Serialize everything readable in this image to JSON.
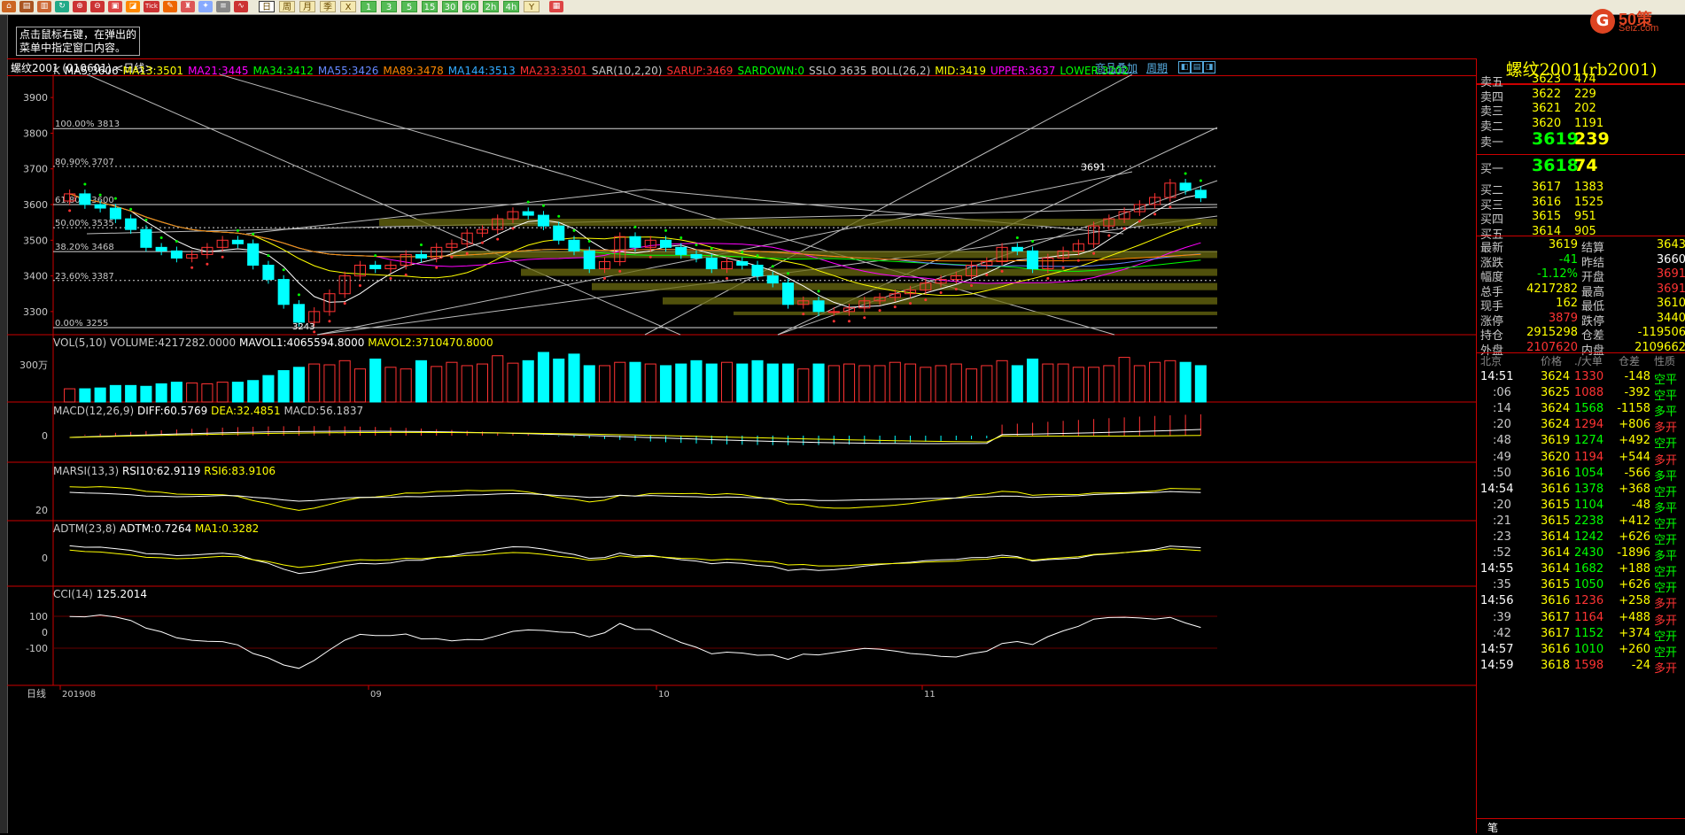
{
  "toolbar": {
    "icons": [
      "home-icon",
      "folder-icon",
      "book-icon",
      "refresh-icon",
      "zoom-in-icon",
      "zoom-out-icon",
      "layers-icon",
      "chart-icon",
      "ink-icon",
      "cup-icon",
      "new-icon",
      "list-icon",
      "line-chart-icon"
    ],
    "tick_label": "Tick",
    "periods": [
      "日",
      "周",
      "月",
      "季",
      "X",
      "1",
      "3",
      "5",
      "15",
      "30",
      "60",
      "2h",
      "4h",
      "Y"
    ],
    "active_period": "日"
  },
  "tooltip": {
    "line1": "点击鼠标右键，在弹出的",
    "line2": "菜单中指定窗口内容。"
  },
  "logo": {
    "mark": "G",
    "text": "50策",
    "sub": "Seiz.com"
  },
  "header": {
    "name": "螺纹2001 (010601) <日线>",
    "link1": "商品叠加",
    "link2": "周期"
  },
  "main": {
    "indicator_items": [
      {
        "text": "K",
        "color": "#c8c8c8"
      },
      {
        "text": "MA5:3606",
        "color": "#ffffff"
      },
      {
        "text": "MA13:3501",
        "color": "#ffff00"
      },
      {
        "text": "MA21:3445",
        "color": "#ff00ff"
      },
      {
        "text": "MA34:3412",
        "color": "#00ff00"
      },
      {
        "text": "MA55:3426",
        "color": "#6688ff"
      },
      {
        "text": "MA89:3478",
        "color": "#ff8800"
      },
      {
        "text": "MA144:3513",
        "color": "#33aaff"
      },
      {
        "text": "MA233:3501",
        "color": "#ff3333"
      },
      {
        "text": "SAR(10,2,20)",
        "color": "#c8c8c8"
      },
      {
        "text": "SARUP:3469",
        "color": "#ff3333"
      },
      {
        "text": "SARDOWN:0",
        "color": "#00ff00"
      },
      {
        "text": "SSLO 3635",
        "color": "#c8c8c8"
      },
      {
        "text": "BOLL(26,2)",
        "color": "#c8c8c8"
      },
      {
        "text": "MID:3419",
        "color": "#ffff00"
      },
      {
        "text": "UPPER:3637",
        "color": "#ff00ff"
      },
      {
        "text": "LOWER:3202",
        "color": "#00ff00"
      }
    ],
    "y_ticks": [
      "3900",
      "3800",
      "3700",
      "3600",
      "3500",
      "3400",
      "3300"
    ],
    "fib_labels": [
      "100.00% 3813",
      "80.90% 3707",
      "61.80% 3600",
      "50.00% 3535",
      "38.20% 3468",
      "23.60% 3387",
      "0.00% 3255"
    ],
    "high_label": "3691",
    "low_label": "3243"
  },
  "vol": {
    "label": "VOL(5,10)",
    "volume": "VOLUME:4217282.0000",
    "mavol1": "MAVOL1:4065594.8000",
    "mavol2": "MAVOL2:3710470.8000",
    "tick": "300万"
  },
  "macd": {
    "label": "MACD(12,26,9)",
    "diff": "DIFF:60.5769",
    "dea": "DEA:32.4851",
    "macd": "MACD:56.1837",
    "tick": "0"
  },
  "marsi": {
    "label": "MARSI(13,3)",
    "rsi10": "RSI10:62.9119",
    "rsi6": "RSI6:83.9106",
    "tick": "20"
  },
  "adtm": {
    "label": "ADTM(23,8)",
    "adtm": "ADTM:0.7264",
    "ma1": "MA1:0.3282",
    "tick": "0"
  },
  "cci": {
    "label": "CCI(14)",
    "value": "125.2014",
    "ticks": [
      "100",
      "0",
      "-100"
    ]
  },
  "xaxis": {
    "period": "日线",
    "labels": [
      "201908",
      "09",
      "10",
      "11"
    ]
  },
  "quote": {
    "title": "螺纹2001(rb2001)",
    "asks": [
      {
        "label": "卖五",
        "price": "3623",
        "vol": "474"
      },
      {
        "label": "卖四",
        "price": "3622",
        "vol": "229"
      },
      {
        "label": "卖三",
        "price": "3621",
        "vol": "202"
      },
      {
        "label": "卖二",
        "price": "3620",
        "vol": "1191"
      },
      {
        "label": "卖一",
        "price": "3619",
        "vol": "239"
      }
    ],
    "bids": [
      {
        "label": "买一",
        "price": "3618",
        "vol": "74"
      },
      {
        "label": "买二",
        "price": "3617",
        "vol": "1383"
      },
      {
        "label": "买三",
        "price": "3616",
        "vol": "1525"
      },
      {
        "label": "买四",
        "price": "3615",
        "vol": "951"
      },
      {
        "label": "买五",
        "price": "3614",
        "vol": "905"
      }
    ],
    "stats": [
      {
        "l1": "最新",
        "v1": "3619",
        "c1": "#ffff00",
        "l2": "结算",
        "v2": "3643",
        "c2": "#ffff00"
      },
      {
        "l1": "涨跌",
        "v1": "-41",
        "c1": "#00ff00",
        "l2": "昨结",
        "v2": "3660",
        "c2": "#ffffff"
      },
      {
        "l1": "幅度",
        "v1": "-1.12%",
        "c1": "#00ff00",
        "l2": "开盘",
        "v2": "3691",
        "c2": "#ff3333"
      },
      {
        "l1": "总手",
        "v1": "4217282",
        "c1": "#ffff00",
        "l2": "最高",
        "v2": "3691",
        "c2": "#ff3333"
      },
      {
        "l1": "现手",
        "v1": "162",
        "c1": "#ffff00",
        "l2": "最低",
        "v2": "3610",
        "c2": "#ffff00"
      },
      {
        "l1": "涨停",
        "v1": "3879",
        "c1": "#ff3333",
        "l2": "跌停",
        "v2": "3440",
        "c2": "#ffff00"
      },
      {
        "l1": "持仓",
        "v1": "2915298",
        "c1": "#ffff00",
        "l2": "仓差",
        "v2": "-119506",
        "c2": "#ffff00"
      },
      {
        "l1": "外盘",
        "v1": "2107620",
        "c1": "#ff3333",
        "l2": "内盘",
        "v2": "2109662",
        "c2": "#ffff00"
      }
    ],
    "ticks_header": {
      "time": "北京",
      "price": "价格",
      "vol": "./大单",
      "diff": "仓差",
      "nature": "性质"
    },
    "ticks": [
      {
        "time": "14:51",
        "price": "3624",
        "vol": "1330",
        "diff": "-148",
        "nature": "空平",
        "tc": "#ffffff",
        "pc": "#ffff00",
        "vc": "#ff3333",
        "dc": "#ffff00",
        "nc": "#00ff00"
      },
      {
        "time": ":06",
        "price": "3625",
        "vol": "1088",
        "diff": "-392",
        "nature": "空平",
        "tc": "#c8c8c8",
        "pc": "#ffff00",
        "vc": "#ff3333",
        "dc": "#ffff00",
        "nc": "#00ff00"
      },
      {
        "time": ":14",
        "price": "3624",
        "vol": "1568",
        "diff": "-1158",
        "nature": "多平",
        "tc": "#c8c8c8",
        "pc": "#ffff00",
        "vc": "#00ff00",
        "dc": "#ffff00",
        "nc": "#00ff00"
      },
      {
        "time": ":20",
        "price": "3624",
        "vol": "1294",
        "diff": "+806",
        "nature": "多开",
        "tc": "#c8c8c8",
        "pc": "#ffff00",
        "vc": "#ff3333",
        "dc": "#ffff00",
        "nc": "#ff3333"
      },
      {
        "time": ":48",
        "price": "3619",
        "vol": "1274",
        "diff": "+492",
        "nature": "空开",
        "tc": "#c8c8c8",
        "pc": "#ffff00",
        "vc": "#00ff00",
        "dc": "#ffff00",
        "nc": "#00ff00"
      },
      {
        "time": ":49",
        "price": "3620",
        "vol": "1194",
        "diff": "+544",
        "nature": "多开",
        "tc": "#c8c8c8",
        "pc": "#ffff00",
        "vc": "#ff3333",
        "dc": "#ffff00",
        "nc": "#ff3333"
      },
      {
        "time": ":50",
        "price": "3616",
        "vol": "1054",
        "diff": "-566",
        "nature": "多平",
        "tc": "#c8c8c8",
        "pc": "#ffff00",
        "vc": "#00ff00",
        "dc": "#ffff00",
        "nc": "#00ff00"
      },
      {
        "time": "14:54",
        "price": "3616",
        "vol": "1378",
        "diff": "+368",
        "nature": "空开",
        "tc": "#ffffff",
        "pc": "#ffff00",
        "vc": "#00ff00",
        "dc": "#ffff00",
        "nc": "#00ff00"
      },
      {
        "time": ":20",
        "price": "3615",
        "vol": "1104",
        "diff": "-48",
        "nature": "多平",
        "tc": "#c8c8c8",
        "pc": "#ffff00",
        "vc": "#00ff00",
        "dc": "#ffff00",
        "nc": "#00ff00"
      },
      {
        "time": ":21",
        "price": "3615",
        "vol": "2238",
        "diff": "+412",
        "nature": "空开",
        "tc": "#c8c8c8",
        "pc": "#ffff00",
        "vc": "#00ff00",
        "dc": "#ffff00",
        "nc": "#00ff00"
      },
      {
        "time": ":23",
        "price": "3614",
        "vol": "1242",
        "diff": "+626",
        "nature": "空开",
        "tc": "#c8c8c8",
        "pc": "#ffff00",
        "vc": "#00ff00",
        "dc": "#ffff00",
        "nc": "#00ff00"
      },
      {
        "time": ":52",
        "price": "3614",
        "vol": "2430",
        "diff": "-1896",
        "nature": "多平",
        "tc": "#c8c8c8",
        "pc": "#ffff00",
        "vc": "#00ff00",
        "dc": "#ffff00",
        "nc": "#00ff00"
      },
      {
        "time": "14:55",
        "price": "3614",
        "vol": "1682",
        "diff": "+188",
        "nature": "空开",
        "tc": "#ffffff",
        "pc": "#ffff00",
        "vc": "#00ff00",
        "dc": "#ffff00",
        "nc": "#00ff00"
      },
      {
        "time": ":35",
        "price": "3615",
        "vol": "1050",
        "diff": "+626",
        "nature": "空开",
        "tc": "#c8c8c8",
        "pc": "#ffff00",
        "vc": "#00ff00",
        "dc": "#ffff00",
        "nc": "#00ff00"
      },
      {
        "time": "14:56",
        "price": "3616",
        "vol": "1236",
        "diff": "+258",
        "nature": "多开",
        "tc": "#ffffff",
        "pc": "#ffff00",
        "vc": "#ff3333",
        "dc": "#ffff00",
        "nc": "#ff3333"
      },
      {
        "time": ":39",
        "price": "3617",
        "vol": "1164",
        "diff": "+488",
        "nature": "多开",
        "tc": "#c8c8c8",
        "pc": "#ffff00",
        "vc": "#ff3333",
        "dc": "#ffff00",
        "nc": "#ff3333"
      },
      {
        "time": ":42",
        "price": "3617",
        "vol": "1152",
        "diff": "+374",
        "nature": "空开",
        "tc": "#c8c8c8",
        "pc": "#ffff00",
        "vc": "#00ff00",
        "dc": "#ffff00",
        "nc": "#00ff00"
      },
      {
        "time": "14:57",
        "price": "3616",
        "vol": "1010",
        "diff": "+260",
        "nature": "空开",
        "tc": "#ffffff",
        "pc": "#ffff00",
        "vc": "#00ff00",
        "dc": "#ffff00",
        "nc": "#00ff00"
      },
      {
        "time": "14:59",
        "price": "3618",
        "vol": "1598",
        "diff": "-24",
        "nature": "多开",
        "tc": "#ffffff",
        "pc": "#ffff00",
        "vc": "#ff3333",
        "dc": "#ffff00",
        "nc": "#ff3333"
      }
    ],
    "bottom_tab": "笔"
  },
  "chart_data": {
    "type": "candlestick",
    "closes": [
      3630,
      3600,
      3590,
      3560,
      3530,
      3480,
      3470,
      3450,
      3460,
      3480,
      3500,
      3490,
      3430,
      3390,
      3320,
      3270,
      3300,
      3350,
      3400,
      3430,
      3420,
      3430,
      3460,
      3450,
      3480,
      3490,
      3520,
      3530,
      3560,
      3580,
      3570,
      3540,
      3500,
      3470,
      3420,
      3440,
      3510,
      3480,
      3500,
      3480,
      3460,
      3450,
      3420,
      3440,
      3430,
      3400,
      3380,
      3320,
      3330,
      3300,
      3300,
      3310,
      3330,
      3340,
      3350,
      3360,
      3380,
      3390,
      3400,
      3430,
      3440,
      3480,
      3470,
      3420,
      3450,
      3470,
      3490,
      3540,
      3560,
      3580,
      3600,
      3620,
      3660,
      3640,
      3619
    ],
    "volumes": [
      160,
      160,
      170,
      200,
      200,
      190,
      220,
      240,
      230,
      220,
      240,
      240,
      260,
      320,
      380,
      420,
      460,
      450,
      500,
      400,
      520,
      420,
      400,
      500,
      430,
      480,
      440,
      460,
      560,
      470,
      500,
      600,
      520,
      580,
      440,
      440,
      480,
      480,
      460,
      440,
      460,
      500,
      460,
      480,
      460,
      500,
      460,
      460,
      400,
      460,
      440,
      460,
      440,
      440,
      480,
      460,
      420,
      440,
      460,
      400,
      440,
      500,
      440,
      520,
      460,
      460,
      420,
      420,
      440,
      540,
      440,
      480,
      500,
      480,
      440,
      500
    ],
    "price_range": [
      3250,
      3950
    ]
  }
}
